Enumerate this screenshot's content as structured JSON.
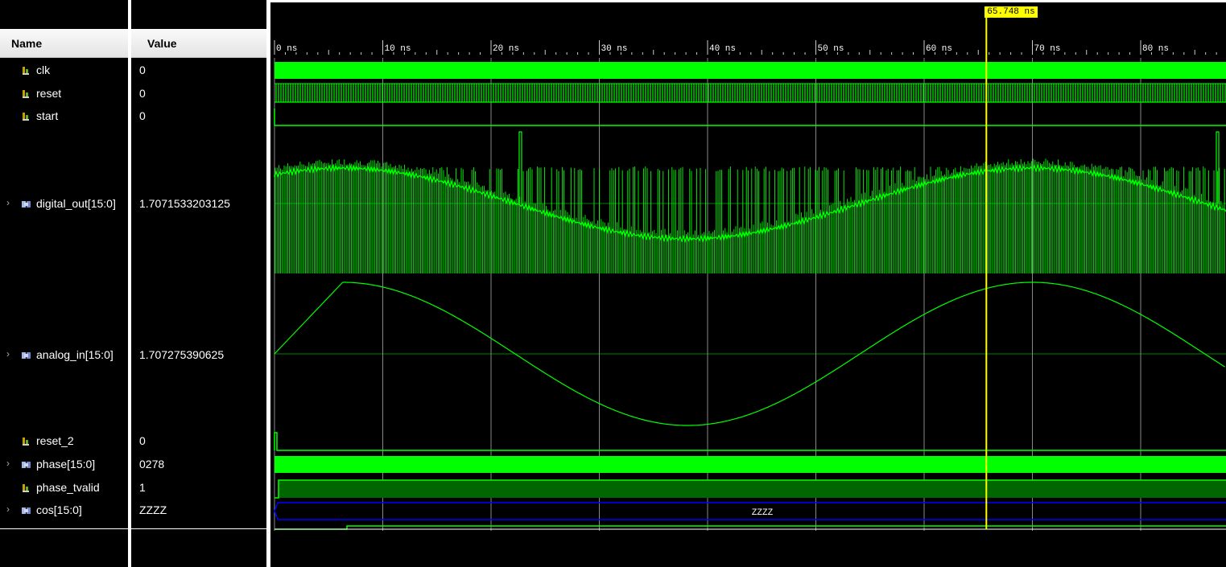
{
  "columns": {
    "name": "Name",
    "value": "Value"
  },
  "signals": [
    {
      "name": "clk",
      "value": "0",
      "kind": "bit",
      "expandable": false
    },
    {
      "name": "reset",
      "value": "0",
      "kind": "bit",
      "expandable": false
    },
    {
      "name": "start",
      "value": "0",
      "kind": "bit",
      "expandable": false
    },
    {
      "name": "digital_out[15:0]",
      "value": "1.7071533203125",
      "kind": "bus",
      "expandable": true
    },
    {
      "name": "analog_in[15:0]",
      "value": "1.707275390625",
      "kind": "bus",
      "expandable": true
    },
    {
      "name": "reset_2",
      "value": "0",
      "kind": "bit",
      "expandable": false
    },
    {
      "name": "phase[15:0]",
      "value": "0278",
      "kind": "bus",
      "expandable": true
    },
    {
      "name": "phase_tvalid",
      "value": "1",
      "kind": "bit",
      "expandable": false
    },
    {
      "name": "cos[15:0]",
      "value": "ZZZZ",
      "kind": "bus",
      "expandable": true
    }
  ],
  "timeline": {
    "ticks": [
      "0 ns",
      "10 ns",
      "20 ns",
      "30 ns",
      "40 ns",
      "50 ns",
      "60 ns",
      "70 ns",
      "80 ns"
    ]
  },
  "cursor": {
    "label": "65.748 ns",
    "time_ns": 65.748
  },
  "bus_text": {
    "cos": "ZZZZ"
  },
  "colors": {
    "wave": "#00ff00",
    "cursor": "#ffff00",
    "bus_z": "#0000ff",
    "grid": "#888888",
    "tvalid_fill": "#006600"
  }
}
